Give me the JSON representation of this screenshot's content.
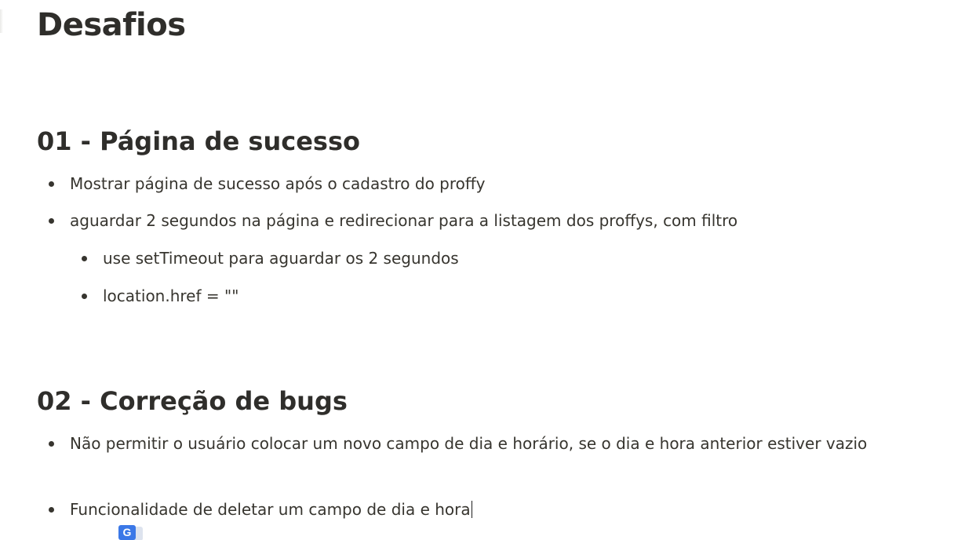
{
  "page": {
    "title": "Desafios"
  },
  "sections": [
    {
      "heading": "01 - Página de sucesso",
      "items": [
        {
          "text": "Mostrar página de sucesso após o cadastro do proffy"
        },
        {
          "text": "aguardar 2 segundos na página e redirecionar para a listagem dos proffys, com filtro"
        },
        {
          "text": "use setTimeout para aguardar os 2 segundos",
          "nested": true
        },
        {
          "text": "location.href = \"\"",
          "nested": true
        }
      ]
    },
    {
      "heading": "02 - Correção de bugs",
      "items": [
        {
          "text": "Não permitir o usuário colocar um novo campo de dia e horário, se o dia e hora anterior estiver vazio"
        },
        {
          "text": "Funcionalidade de deletar um campo de dia e hora"
        }
      ]
    }
  ],
  "icons": {
    "translate": "google-translate-icon",
    "translate_glyph": "G"
  }
}
